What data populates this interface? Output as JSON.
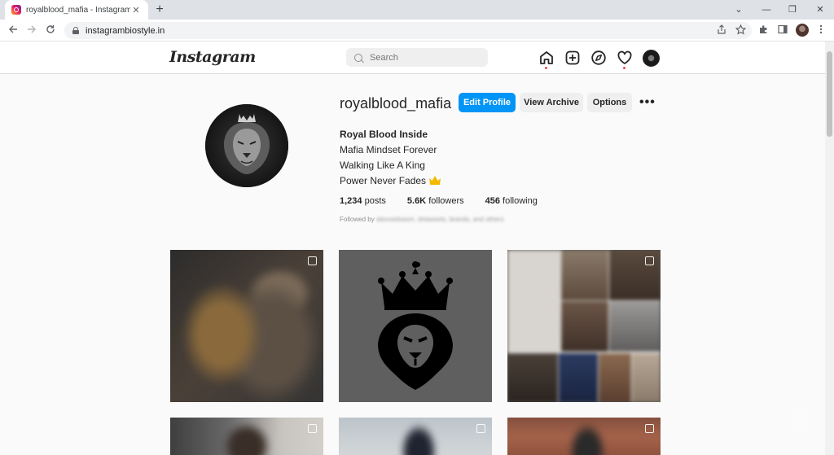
{
  "browser": {
    "tab_title": "royalblood_mafia - Instagram",
    "tab_close": "✕",
    "new_tab": "+",
    "url": "instagrambiostyle.in",
    "controls": {
      "minimize": "⌄",
      "min": "—",
      "restore": "❐",
      "close": "✕"
    }
  },
  "header": {
    "logo": "Instagram",
    "search_placeholder": "Search"
  },
  "profile": {
    "username": "royalblood_mafia",
    "edit_profile": "Edit Profile",
    "view_archive": "View Archive",
    "options": "Options",
    "more": "•••",
    "bio_name": "Royal Blood Inside",
    "bio_lines": [
      "Mafia Mindset Forever",
      "Walking Like A King",
      "Power Never Fades"
    ],
    "posts_count": "1,234",
    "posts_label": "posts",
    "followers_count": "5.6K",
    "followers_label": "followers",
    "following_count": "456",
    "following_label": "following",
    "followed_by_prefix": "Followed by",
    "followed_by_names": "alexvedsasm, drtawsets, brands, and others"
  },
  "colors": {
    "accent": "#0095f6",
    "notification": "#ed4956"
  }
}
